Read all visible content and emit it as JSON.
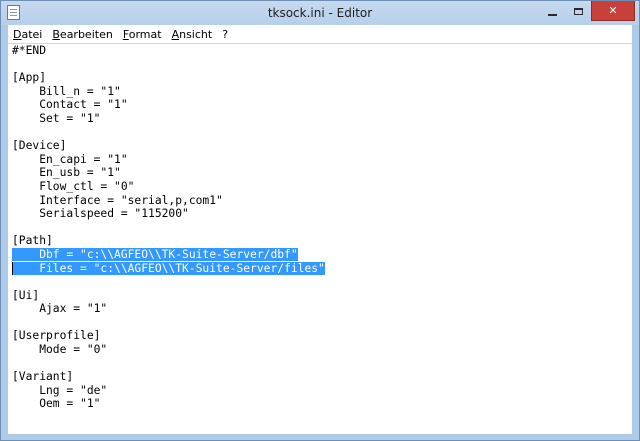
{
  "window": {
    "title": "tksock.ini - Editor"
  },
  "menu": {
    "items": [
      "Datei",
      "Bearbeiten",
      "Format",
      "Ansicht",
      "?"
    ]
  },
  "editor": {
    "lines": [
      "#*END",
      "",
      "[App]",
      "    Bill_n = \"1\"",
      "    Contact = \"1\"",
      "    Set = \"1\"",
      "",
      "[Device]",
      "    En_capi = \"1\"",
      "    En_usb = \"1\"",
      "    Flow_ctl = \"0\"",
      "    Interface = \"serial,p,com1\"",
      "    Serialspeed = \"115200\"",
      "",
      "[Path]",
      "    Dbf = \"c:\\\\AGFEO\\\\TK-Suite-Server/dbf\"",
      "    Files = \"c:\\\\AGFEO\\\\TK-Suite-Server/files\"",
      "",
      "[Ui]",
      "    Ajax = \"1\"",
      "",
      "[Userprofile]",
      "    Mode = \"0\"",
      "",
      "[Variant]",
      "    Lng = \"de\"",
      "    Oem = \"1\""
    ],
    "selected_lines": [
      15,
      16
    ]
  },
  "colors": {
    "selection": "#3399ff",
    "close_button": "#c7413a",
    "frame": "#aecbe9"
  }
}
